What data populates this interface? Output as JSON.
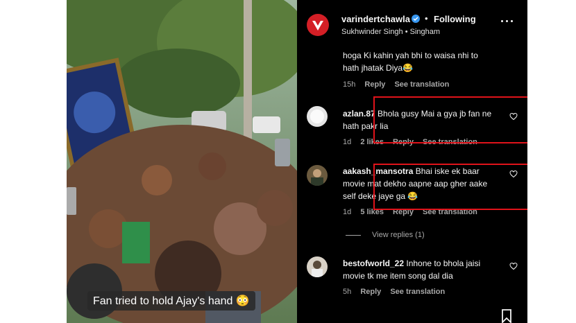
{
  "post": {
    "username": "varindertchawla",
    "follow_status": "Following",
    "separator": "•",
    "subtitle": "Sukhwinder Singh • Singham",
    "video_caption": "Fan tried to hold Ajay's hand 😳"
  },
  "comments": [
    {
      "text": "hoga Ki kahin yah bhi to waisa nhi to hath jhatak Diya😂",
      "time": "15h",
      "reply": "Reply",
      "translation": "See translation"
    },
    {
      "username": "azlan.87",
      "text": "Bhola gusy Mai a gya jb fan ne hath pakr lia",
      "time": "1d",
      "likes": "2 likes",
      "reply": "Reply",
      "translation": "See translation"
    },
    {
      "username": "aakash_mansotra",
      "text": "Bhai iske ek baar movie mat dekho aapne aap gher aake self deke jaye ga 😂",
      "time": "1d",
      "likes": "5 likes",
      "reply": "Reply",
      "translation": "See translation"
    },
    {
      "username": "bestofworld_22",
      "text": "Inhone to bhola jaisi movie tk me item song dal dia",
      "time": "5h",
      "reply": "Reply",
      "translation": "See translation"
    }
  ],
  "view_replies": "View replies (1)",
  "colors": {
    "highlight_box": "#e0131a",
    "verified": "#3897f0",
    "brand_logo": "#d41f26"
  },
  "icons": [
    "more-options-icon",
    "verified-badge-icon",
    "heart-icon",
    "bookmark-icon",
    "brand-logo-icon"
  ]
}
